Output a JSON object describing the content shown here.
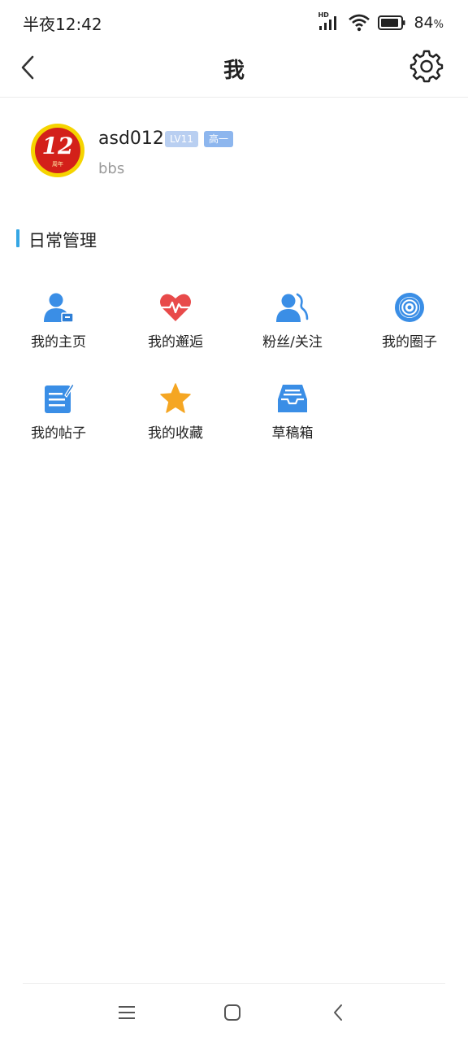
{
  "status_bar": {
    "time": "半夜12:42",
    "hd_label": "HD",
    "battery": "84",
    "battery_unit": "%"
  },
  "header": {
    "title": "我",
    "back_icon": "chevron-left-icon",
    "settings_icon": "gear-icon"
  },
  "profile": {
    "avatar_number": "12",
    "avatar_caption": "周年",
    "username": "asd012",
    "level_badge": "LV11",
    "grade_badge": "高一",
    "subtitle": "bbs"
  },
  "section": {
    "title": "日常管理"
  },
  "grid": [
    {
      "label": "我的主页",
      "icon": "user-home-icon"
    },
    {
      "label": "我的邂逅",
      "icon": "heartbeat-icon"
    },
    {
      "label": "粉丝/关注",
      "icon": "fans-icon"
    },
    {
      "label": "我的圈子",
      "icon": "circle-target-icon"
    },
    {
      "label": "我的帖子",
      "icon": "edit-note-icon"
    },
    {
      "label": "我的收藏",
      "icon": "star-icon"
    },
    {
      "label": "草稿箱",
      "icon": "inbox-tray-icon"
    }
  ],
  "colors": {
    "accent_blue": "#3a8ee6",
    "section_bar": "#35a6e4",
    "heart_red": "#e84a4a",
    "star_orange": "#f5a623"
  },
  "nav": {
    "menu_icon": "menu-icon",
    "home_icon": "home-square-icon",
    "back_icon": "back-icon"
  }
}
